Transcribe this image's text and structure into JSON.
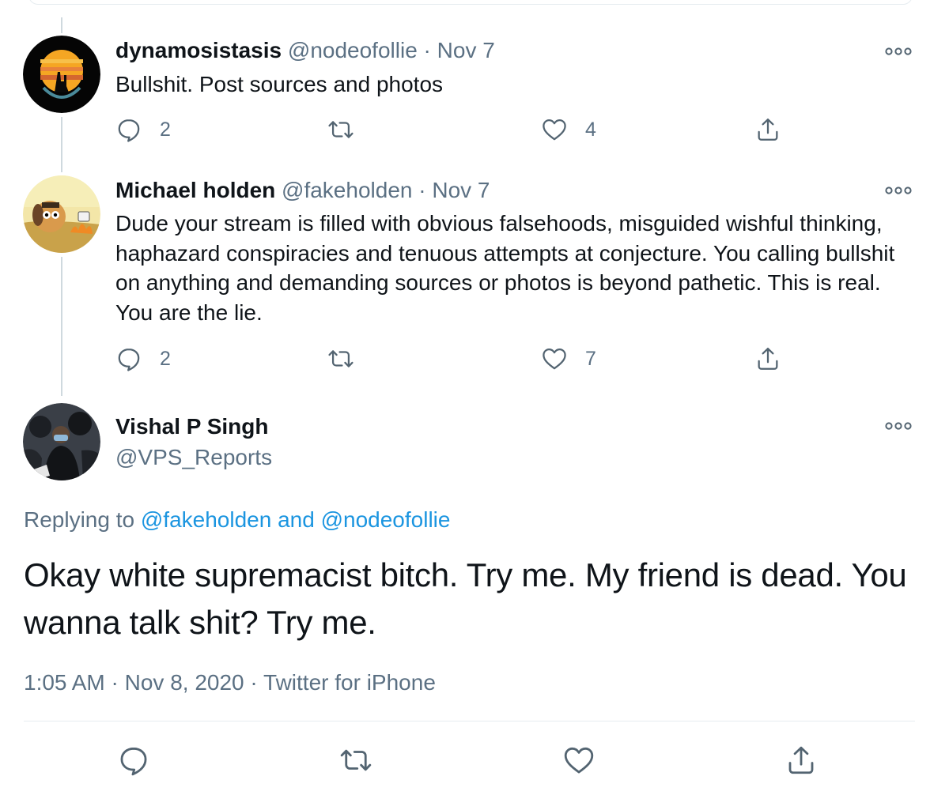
{
  "replies": [
    {
      "name": "dynamosistasis",
      "handle": "@nodeofollie",
      "separator": "·",
      "date": "Nov 7",
      "text": "Bullshit. Post sources and photos",
      "reply_count": "2",
      "retweet_count": "",
      "like_count": "4"
    },
    {
      "name": "Michael holden",
      "handle": "@fakeholden",
      "separator": "·",
      "date": "Nov 7",
      "text": "Dude your stream is filled with obvious falsehoods, misguided wishful thinking, haphazard conspiracies and tenuous attempts at conjecture. You calling bullshit on anything and demanding sources or photos is beyond pathetic.  This is real. You are the lie.",
      "reply_count": "2",
      "retweet_count": "",
      "like_count": "7"
    }
  ],
  "main_tweet": {
    "name": "Vishal P Singh",
    "handle": "@VPS_Reports",
    "replying_prefix": "Replying to",
    "replying_user1": "@fakeholden",
    "replying_and": "and",
    "replying_user2": "@nodeofollie",
    "text": "Okay white supremacist bitch. Try me. My friend is dead. You wanna talk shit? Try me.",
    "time": "1:05 AM",
    "separator": "·",
    "date": "Nov 8, 2020",
    "source": "Twitter for iPhone"
  },
  "icons": {
    "reply": "reply-icon",
    "retweet": "retweet-icon",
    "like": "heart-icon",
    "share": "share-icon",
    "more": "more-icon"
  },
  "colors": {
    "text": "#0f1419",
    "muted": "#5b7083",
    "link": "#1b95e0",
    "icon": "#536471",
    "border": "#e6ecf0"
  }
}
